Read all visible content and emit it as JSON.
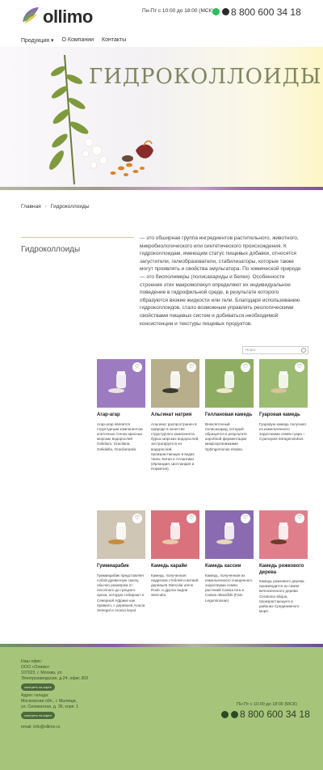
{
  "header": {
    "logo_text": "ollimo",
    "hours": "Пн-Пт с 10:00 до 18:00 (МСК)",
    "phone": "8 800 600 34 18"
  },
  "nav": {
    "products": "Продукция",
    "about": "О Компании",
    "contacts": "Контакты"
  },
  "hero": {
    "title": "ГИДРОКОЛЛОИДЫ"
  },
  "breadcrumb": {
    "home": "Главная",
    "separator": "›",
    "current": "Гидроколлоиды"
  },
  "intro": {
    "title": "Гидроколлоиды",
    "text": "— это обширная группа ингредиентов растительного, животного, микробиологического или синтетического происхождения. К гидроколлоидам, имеющим статус пищевых добавок, относятся загустители, гелеобразователи, стабилизаторы, которые также могут проявлять и свойства эмульгатора. По химической природе — это биополимеры (полисахариды и белки). Особенности строения этих макромолекул определяют их индивидуальное поведение в гидрофильной среде, в результате которого образуются вязкие жидкости или гели. Благодаря использованию гидроколлоидов, стало возможным управлять реологическими свойствами пищевых систем и добиваться необходимой консистенции и текстуры пищевых продуктов."
  },
  "search": {
    "placeholder": "Поиск"
  },
  "products": [
    {
      "name": "Агар-агар",
      "desc": "Агар-агар является структурным компонентом клеточных стенок красных морских водорослей Gelidium, Gracilaria, Gelidiella, Gracilaropsis.",
      "bg": "#9c7bc0",
      "powder": "#e9e4dc"
    },
    {
      "name": "Альгинат натрия",
      "desc": "Альгинат распространен в природе в качестве структурного компонента бурых морских водорослей, экстрагируется из водорослей, произрастающих в водах Чили, Китая и Атлантики (Ирландия, Шотландия и Норвегия).",
      "bg": "#b7ae8c",
      "powder": "#3a3a30"
    },
    {
      "name": "Геллановая камедь",
      "desc": "Внеклеточный полисахарид, который образуется в результате аэробной ферментации микроорганизмами Sphingomonas elodea.",
      "bg": "#8fad62",
      "powder": "#efe6d0"
    },
    {
      "name": "Гуаровая камедь",
      "desc": "Гуаровую камедь получают из измельченного эндосперма семян гуара – Cyamopsis tetragonolobus.",
      "bg": "#9dbb73",
      "powder": "#d8c39a"
    },
    {
      "name": "Гуммиарабик",
      "desc": "Гуммиарабик представляет собой древесную смолу, обычно размером от песочного до грецкого ореха, которую собирают в Северной Африке как правило, с деревьев Acacia Senegal и Acacia seyal.",
      "bg": "#cfc6b5",
      "powder": "#c98a3e"
    },
    {
      "name": "Камедь карайи",
      "desc": "Камедь, полученная надрезом стеблей и ветвей деревьев Sterculia urens Roxb. и других видов Sterculia.",
      "bg": "#d9727c",
      "powder": "#e9c9a8"
    },
    {
      "name": "Камедь кассии",
      "desc": "Камедь, полученная из измельченного очищенного эндосперма семян растений Cassia tora и Cassia obtusifolii (Fam. Leguminosae).",
      "bg": "#8a6ab0",
      "powder": "#e7d6b8"
    },
    {
      "name": "Камедь рожкового дерева",
      "desc": "Камедь рожкового дерева производится из семян вечнозеленого дерева Ceratonia siliqua, произрастающего в районах Средиземного моря.",
      "bg": "#e07f8c",
      "powder": "#6a3c2c"
    }
  ],
  "footer": {
    "office_label": "Наш офис:",
    "office_company": "ООО «Олимо»",
    "office_address1": "107023, г. Москва, ул.",
    "office_address2": "Электрозаводская, д.24, офис 303",
    "map_button": "смотреть на карте",
    "warehouse_label": "Адрес склада:",
    "warehouse_address1": "Московская обл., г. Мытищи,",
    "warehouse_address2": "ул. Силикатная, д. 36, корп. 1",
    "email": "email: info@ollimo.ru",
    "hours": "Пн-Пт с 10:00 до 18:00 (МСК)",
    "phone": "8 800 600 34 18"
  }
}
